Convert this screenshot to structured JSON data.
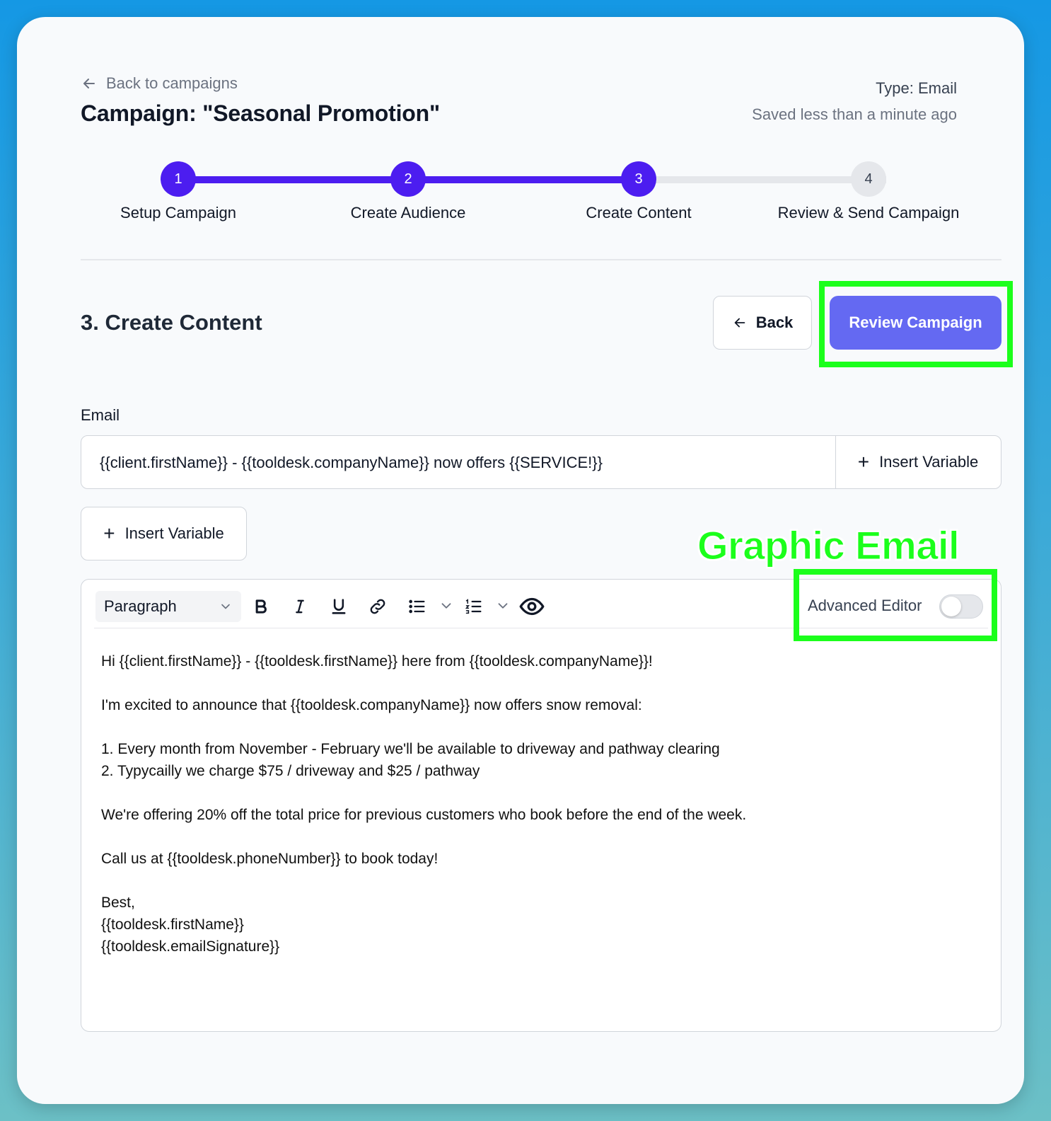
{
  "header": {
    "back_link": "Back to campaigns",
    "title": "Campaign: \"Seasonal Promotion\"",
    "type": "Type: Email",
    "saved": "Saved less than a minute ago"
  },
  "stepper": {
    "steps": [
      {
        "number": "1",
        "label": "Setup Campaign",
        "active": true
      },
      {
        "number": "2",
        "label": "Create Audience",
        "active": true
      },
      {
        "number": "3",
        "label": "Create Content",
        "active": true
      },
      {
        "number": "4",
        "label": "Review & Send Campaign",
        "active": false
      }
    ],
    "active_color": "#4c1df0",
    "inactive_color": "#e5e7eb"
  },
  "section": {
    "title": "3. Create Content",
    "back_button": "Back",
    "review_button": "Review Campaign"
  },
  "annotation": {
    "label": "Graphic Email",
    "highlight_color": "#1bff1b"
  },
  "email": {
    "label": "Email",
    "subject_value": "{{client.firstName}} - {{tooldesk.companyName}} now offers {{SERVICE!}}",
    "subject_insert_label": "Insert Variable",
    "insert_variable_label": "Insert Variable"
  },
  "editor": {
    "paragraph_select": "Paragraph",
    "advanced_editor_label": "Advanced Editor",
    "advanced_editor_enabled": false,
    "toolbar_icons": [
      "bold-icon",
      "italic-icon",
      "underline-icon",
      "link-icon",
      "bullet-list-icon",
      "numbered-list-icon",
      "eye-icon"
    ],
    "body_lines": [
      "Hi {{client.firstName}} - {{tooldesk.firstName}} here from {{tooldesk.companyName}}!",
      "",
      "I'm excited to announce that {{tooldesk.companyName}} now offers snow removal:",
      "",
      "1. Every month from November - February we'll be available to driveway and pathway clearing",
      "2. Typycailly we charge $75 / driveway and $25 / pathway",
      "",
      "We're offering 20% off the total price for previous customers who book before the end of the week.",
      "",
      "Call us at {{tooldesk.phoneNumber}} to book today!",
      "",
      "Best,",
      "{{tooldesk.firstName}}",
      "{{tooldesk.emailSignature}}"
    ]
  },
  "colors": {
    "primary_button": "#6469f2",
    "accent": "#4c1df0"
  }
}
